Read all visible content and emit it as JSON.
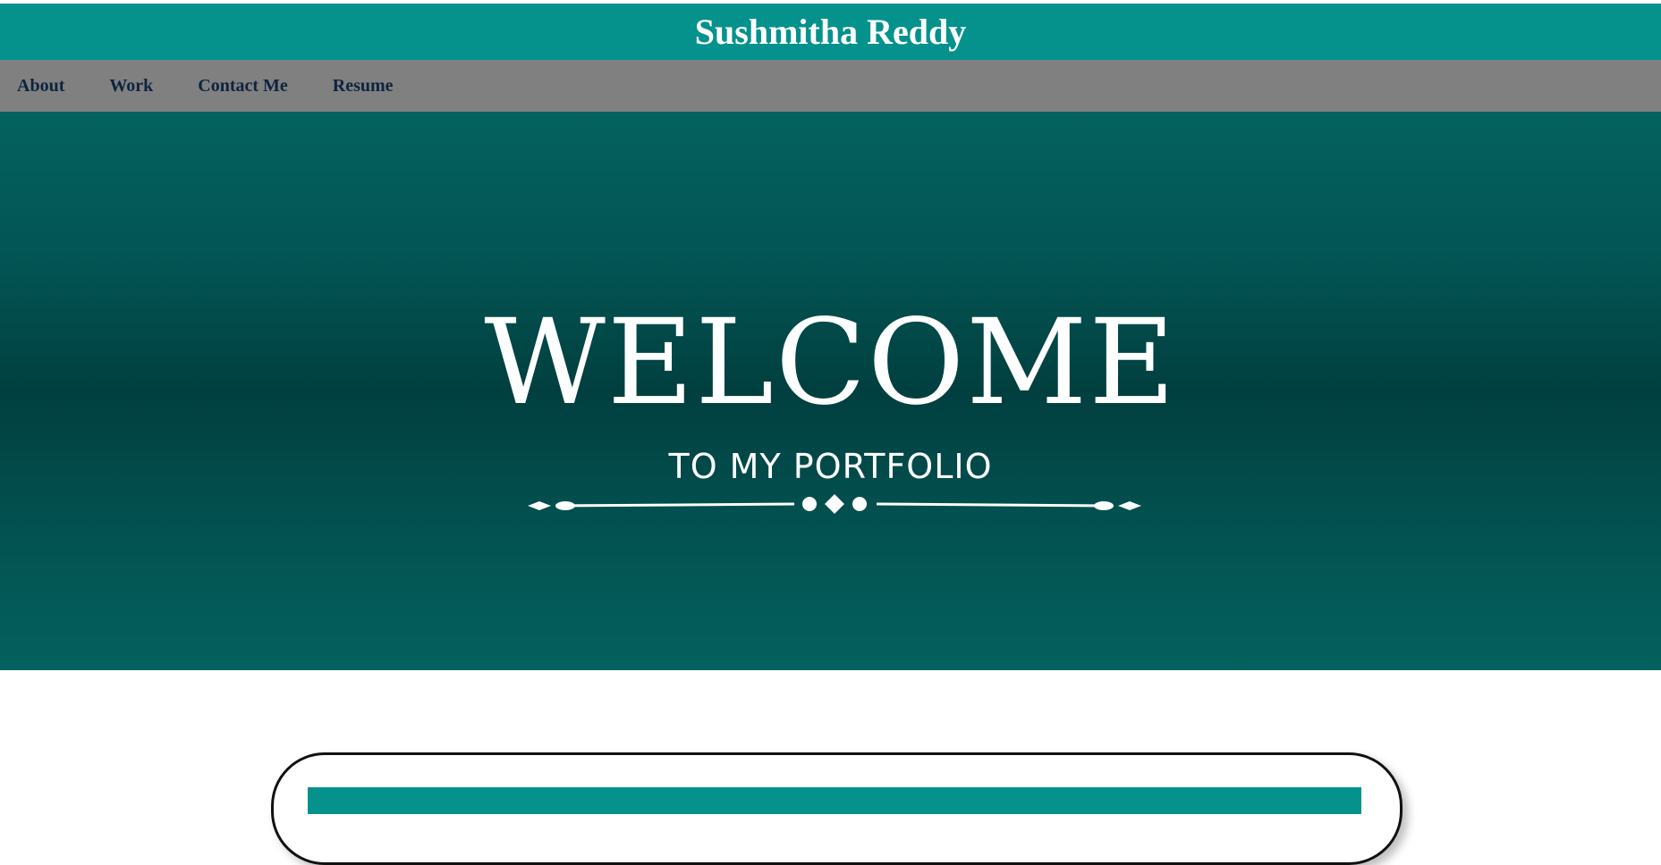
{
  "header": {
    "title": "Sushmitha Reddy"
  },
  "nav": {
    "items": [
      {
        "label": "About"
      },
      {
        "label": "Work"
      },
      {
        "label": "Contact Me"
      },
      {
        "label": "Resume"
      }
    ]
  },
  "hero": {
    "title": "WELCOME",
    "subtitle": "TO MY PORTFOLIO",
    "divider_icon": "ornamental-divider-icon"
  },
  "colors": {
    "header_bg": "#05928d",
    "nav_bg": "#808080",
    "nav_text": "#0f2340",
    "hero_dark": "#013f3f",
    "hero_light": "#04625f"
  }
}
